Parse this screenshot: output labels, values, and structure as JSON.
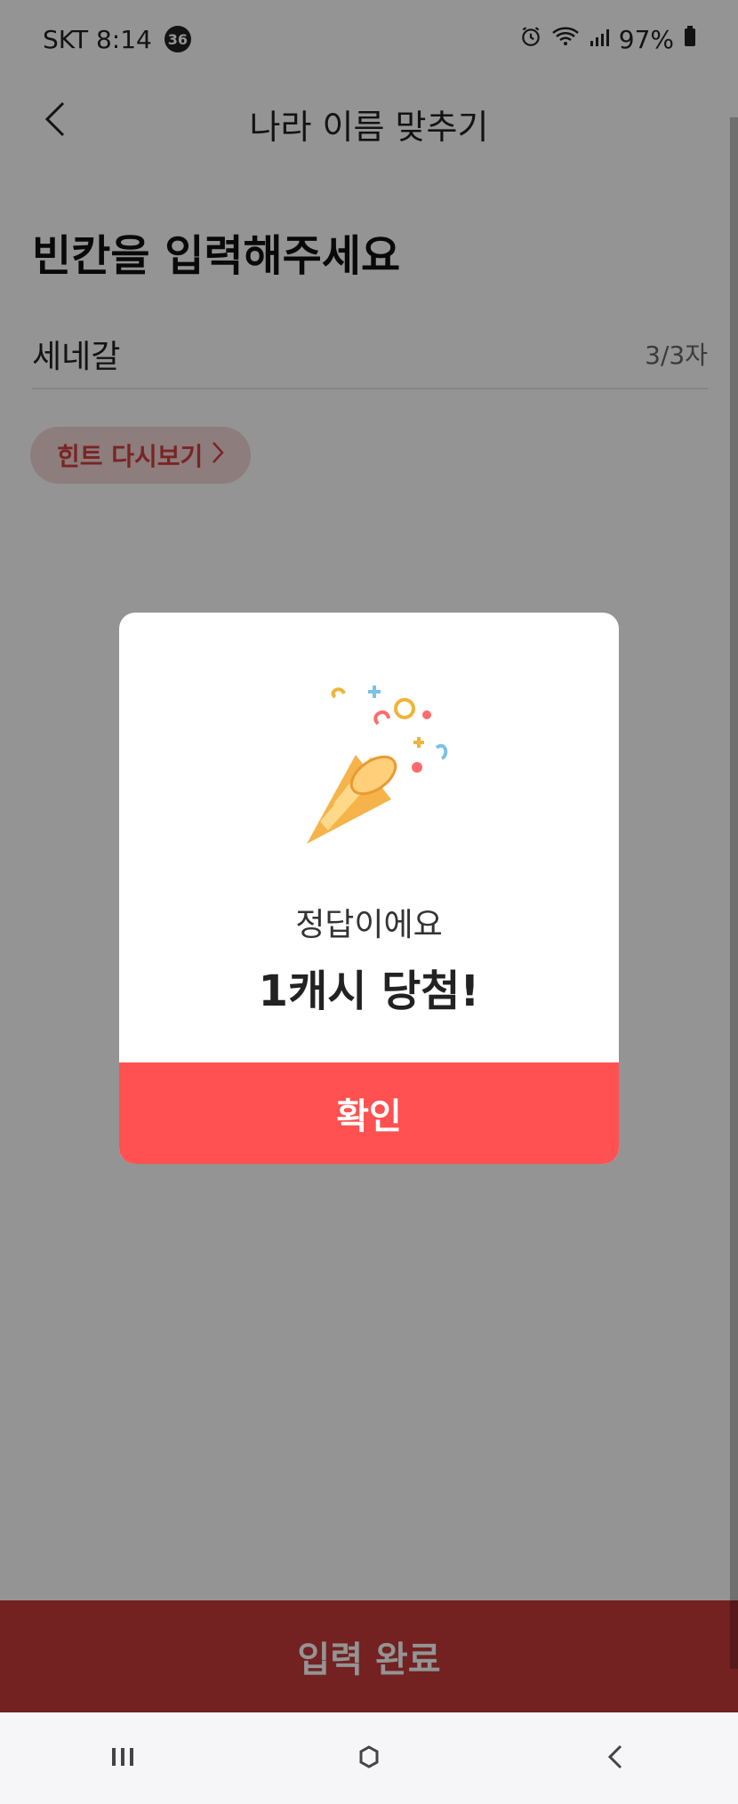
{
  "status_bar": {
    "carrier_time": "SKT 8:14",
    "notification_count": "36",
    "battery": "97%"
  },
  "header": {
    "title": "나라 이름 맞추기"
  },
  "main": {
    "prompt": "빈칸을 입력해주세요",
    "answer_value": "세네갈",
    "char_counter": "3/3자",
    "hint_button_label": "힌트 다시보기",
    "submit_label": "입력 완료"
  },
  "modal": {
    "message": "정답이에요",
    "reward": "1캐시 당첨!",
    "confirm_label": "확인",
    "art_icon": "party-popper-icon"
  },
  "colors": {
    "accent": "#ff5151",
    "submit_bg": "#c73a3a",
    "hint_bg": "#f3d7d7",
    "hint_text": "#d23f3f"
  },
  "nav": {
    "recent_icon": "recent-apps-icon",
    "home_icon": "home-icon",
    "back_icon": "back-icon"
  }
}
